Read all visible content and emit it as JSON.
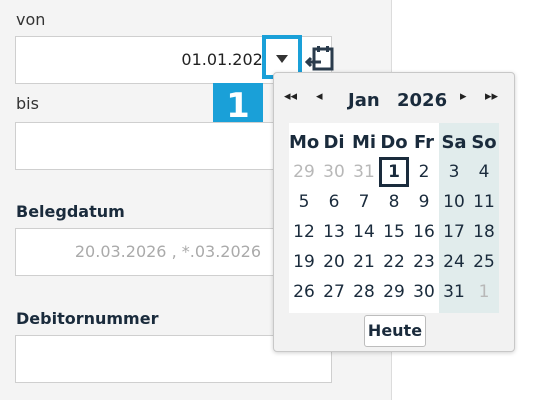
{
  "form": {
    "from_label": "von",
    "from_value": "01.01.2026",
    "to_label": "bis",
    "to_value": "",
    "belegdatum_label": "Belegdatum",
    "belegdatum_placeholder": "20.03.2026 , *.03.2026",
    "debitor_label": "Debitornummer",
    "debitor_value": ""
  },
  "step_badge": "1",
  "calendar": {
    "month": "Jan",
    "year": "2026",
    "nav": {
      "prev_year": "◂◂",
      "prev_month": "◂",
      "next_month": "▸",
      "next_year": "▸▸"
    },
    "weekdays": [
      "Mo",
      "Di",
      "Mi",
      "Do",
      "Fr",
      "Sa",
      "So"
    ],
    "weeks": [
      [
        "29",
        "30",
        "31",
        "1",
        "2",
        "3",
        "4"
      ],
      [
        "5",
        "6",
        "7",
        "8",
        "9",
        "10",
        "11"
      ],
      [
        "12",
        "13",
        "14",
        "15",
        "16",
        "17",
        "18"
      ],
      [
        "19",
        "20",
        "21",
        "22",
        "23",
        "24",
        "25"
      ],
      [
        "26",
        "27",
        "28",
        "29",
        "30",
        "31",
        "1"
      ]
    ],
    "today_button": "Heute"
  },
  "colors": {
    "accent": "#1aa0d8",
    "weekend_bg": "#e1ecec",
    "text": "#1a2b3c"
  },
  "icons": [
    "chevron-down-icon",
    "calendar-swap-icon"
  ]
}
